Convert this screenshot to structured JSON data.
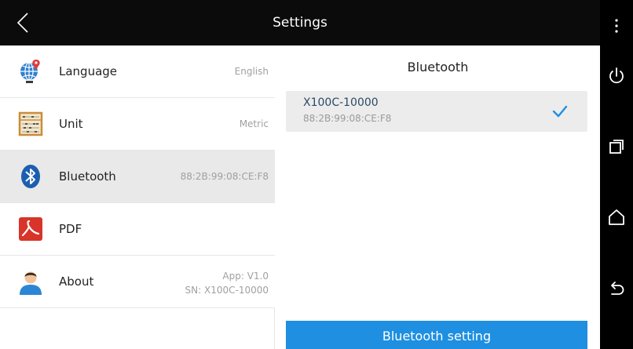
{
  "titlebar": {
    "title": "Settings"
  },
  "sidebar": {
    "items": [
      {
        "label": "Language",
        "value": "English",
        "icon": "globe-pin-icon"
      },
      {
        "label": "Unit",
        "value": "Metric",
        "icon": "abacus-icon"
      },
      {
        "label": "Bluetooth",
        "value": "88:2B:99:08:CE:F8",
        "icon": "bluetooth-icon",
        "selected": true
      },
      {
        "label": "PDF",
        "value": "",
        "icon": "pdf-icon"
      },
      {
        "label": "About",
        "value": "App: V1.0",
        "value2": "SN: X100C-10000",
        "icon": "user-avatar-icon"
      }
    ]
  },
  "content": {
    "heading": "Bluetooth",
    "device": {
      "name": "X100C-10000",
      "address": "88:2B:99:08:CE:F8",
      "connected": true
    },
    "button_label": "Bluetooth setting"
  },
  "navbar": {
    "icons": [
      "more-vert-icon",
      "power-icon",
      "recent-apps-icon",
      "home-icon",
      "back-icon"
    ]
  },
  "colors": {
    "accent": "#1E8FE1",
    "titlebar_bg": "#0B0B0B",
    "selected_bg": "#E9E9E9",
    "check": "#1E8FE1"
  }
}
